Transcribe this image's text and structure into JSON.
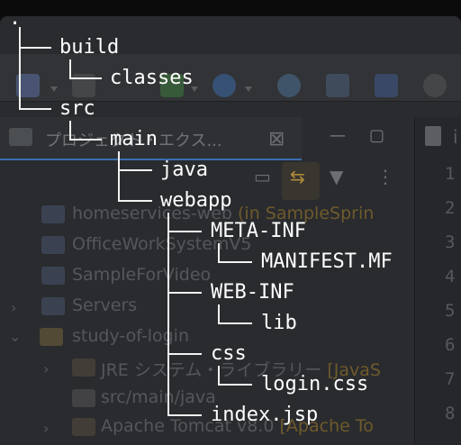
{
  "background_ui": {
    "panel_title": "プロジェクト・エクス...",
    "close_glyph": "⊠",
    "editor_tab_text": "i",
    "line_numbers": [
      "1",
      "2",
      "3",
      "4",
      "5",
      "6",
      "7",
      "8"
    ],
    "projects": [
      {
        "name": "homeservices-web",
        "note": "(in SampleSprin"
      },
      {
        "name": "OfficeWorkSystemV5",
        "note": ""
      },
      {
        "name": "SampleForVideo",
        "note": ""
      },
      {
        "name": "Servers",
        "note": ""
      },
      {
        "name": "study-of-login",
        "note": ""
      },
      {
        "name": "JRE システム・ライブラリー",
        "note": "[JavaS"
      },
      {
        "name": "src/main/java",
        "note": ""
      },
      {
        "name": "Apache Tomcat v8.0",
        "note": "[Apache To"
      }
    ],
    "colors": {
      "window": "#2a2b2e",
      "accent": "#3a6fb0",
      "tree_text": "#ffffff"
    }
  },
  "tree": {
    "root": ".",
    "nodes": [
      {
        "name": "build"
      },
      {
        "name": "classes"
      },
      {
        "name": "src"
      },
      {
        "name": "main"
      },
      {
        "name": "java"
      },
      {
        "name": "webapp"
      },
      {
        "name": "META-INF"
      },
      {
        "name": "MANIFEST.MF"
      },
      {
        "name": "WEB-INF"
      },
      {
        "name": "lib"
      },
      {
        "name": "css"
      },
      {
        "name": "login.css"
      },
      {
        "name": "index.jsp"
      }
    ]
  }
}
